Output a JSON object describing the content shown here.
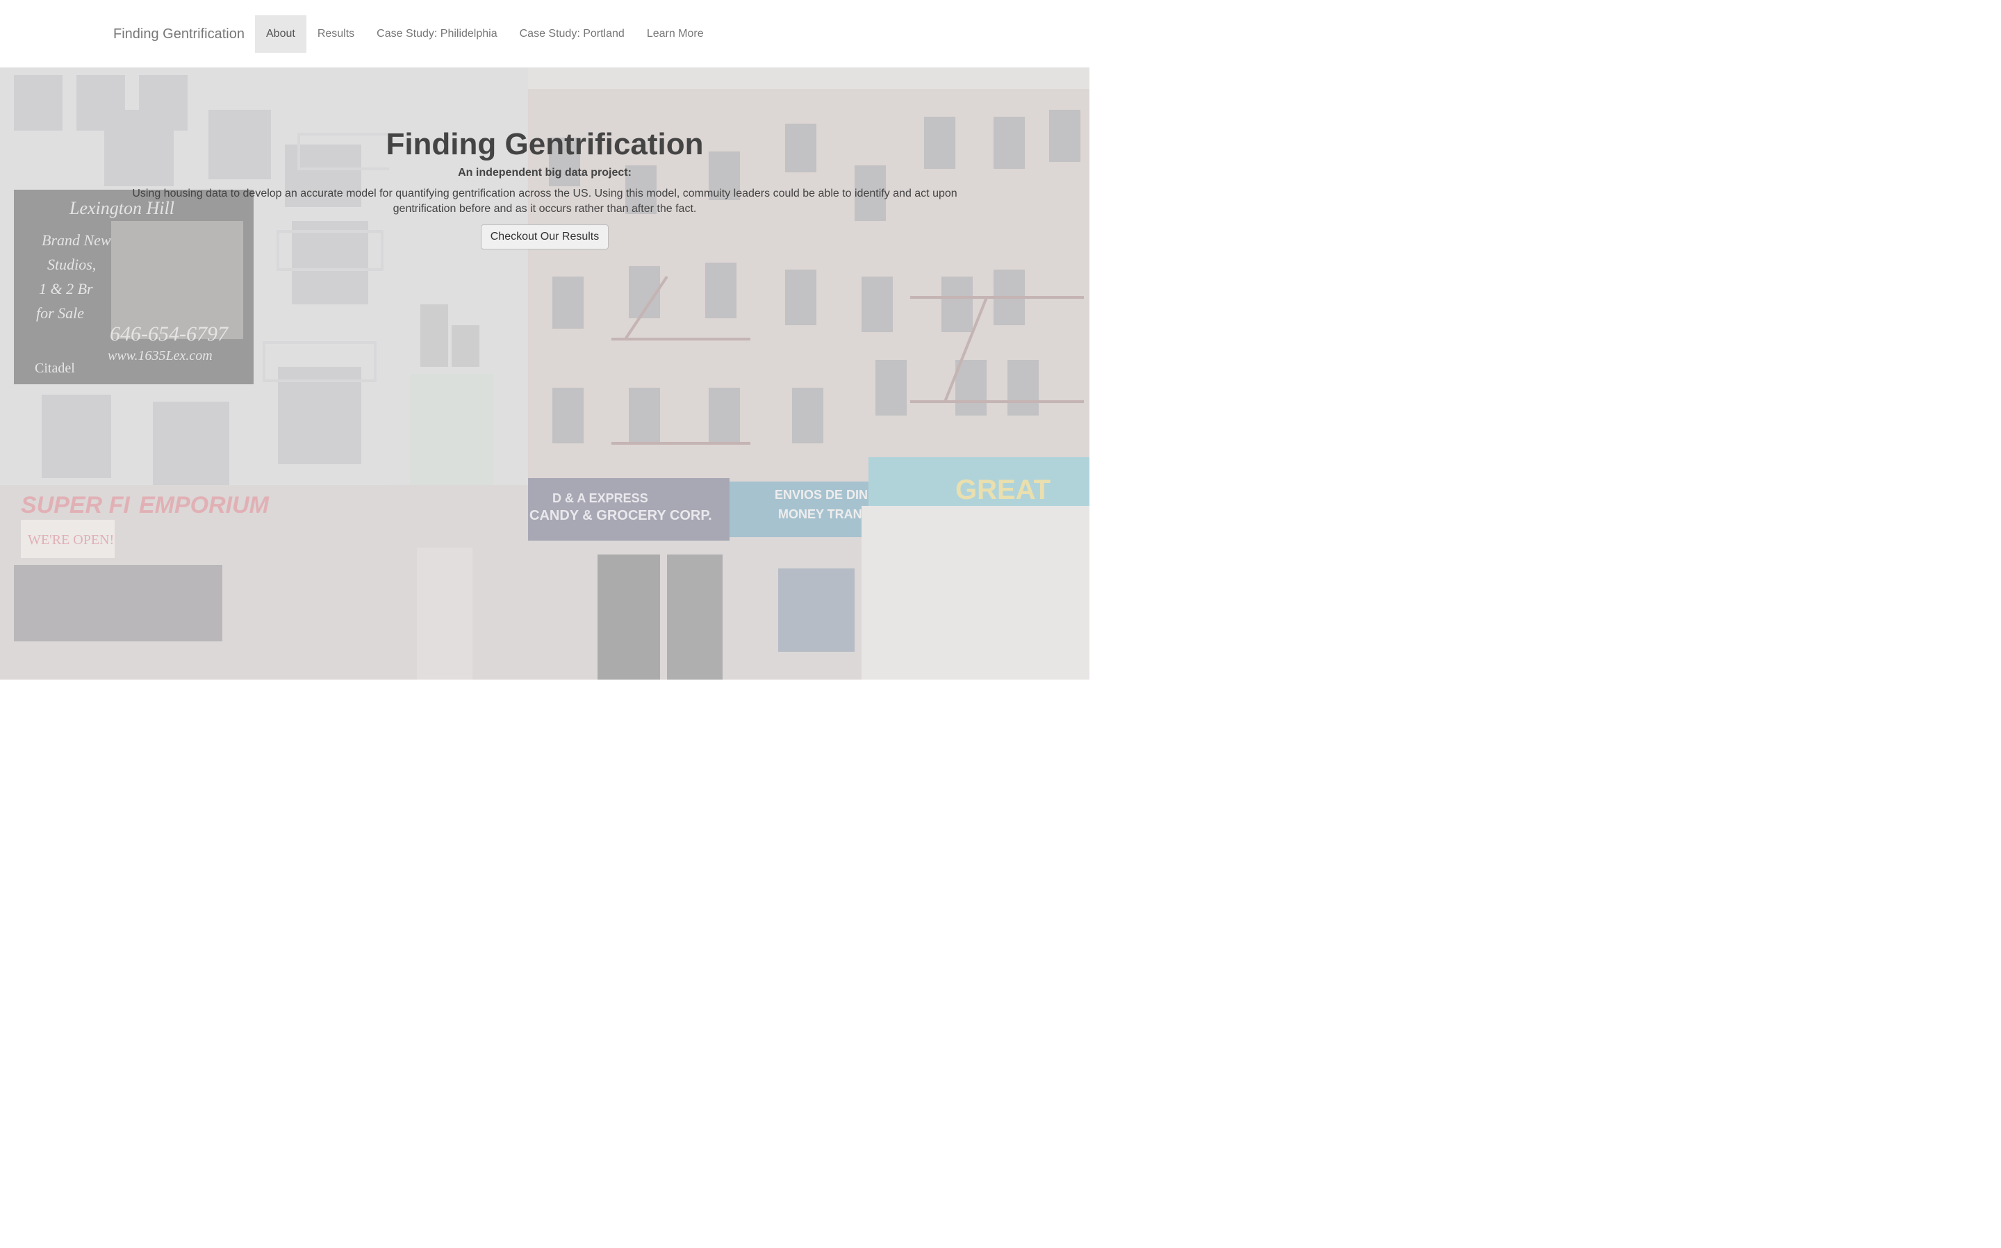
{
  "navbar": {
    "brand": "Finding Gentrification",
    "items": [
      {
        "label": "About",
        "active": true
      },
      {
        "label": "Results",
        "active": false
      },
      {
        "label": "Case Study: Philidelphia",
        "active": false
      },
      {
        "label": "Case Study: Portland",
        "active": false
      },
      {
        "label": "Learn More",
        "active": false
      }
    ]
  },
  "hero": {
    "title": "Finding Gentrification",
    "subtitle": "An independent big data project:",
    "description": "Using housing data to develop an accurate model for quantifying gentrification across the US. Using this model, commuity leaders could be able to identify and act upon gentrification before and as it occurs rather than after the fact.",
    "button_label": "Checkout Our Results",
    "background_sign_lines": [
      "Lexington Hill",
      "Brand New",
      "Studios,",
      "1 & 2 Br",
      "for Sale",
      "646-654-6797",
      "www.1635Lex.com",
      "Citadel",
      "SUPER FI",
      "EMPORIUM",
      "WE'RE OPEN!",
      "D & A EXPRESS",
      "CANDY & GROCERY CORP.",
      "ENVIOS DE DINERO",
      "MONEY TRANSFERS",
      "GREAT"
    ]
  },
  "colors": {
    "nav_active_bg": "#e7e7e7",
    "nav_text": "#777777",
    "hero_text": "#444444"
  }
}
